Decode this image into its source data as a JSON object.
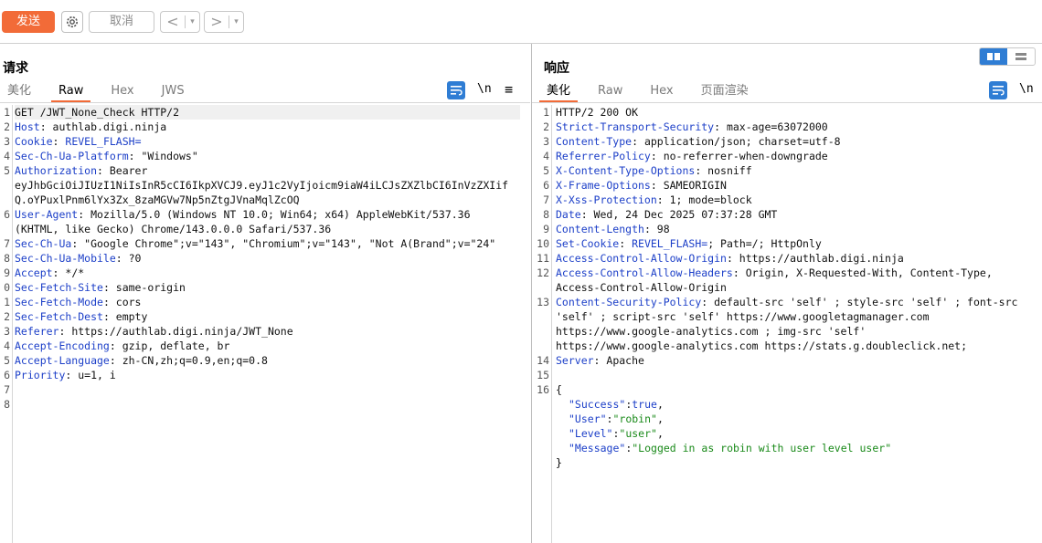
{
  "toolbar": {
    "send": "发送",
    "cancel": "取消",
    "back": "<",
    "forward": ">",
    "dropdown": "▾"
  },
  "request": {
    "title": "请求",
    "tabs": [
      "美化",
      "Raw",
      "Hex",
      "JWS"
    ],
    "active_tab": "Raw",
    "newline_label": "\\n",
    "menu_label": "≡",
    "lines": [
      {
        "num": "1",
        "k": "",
        "v": "GET /JWT_None_Check HTTP/2"
      },
      {
        "num": "2",
        "k": "Host",
        "v": ": authlab.digi.ninja"
      },
      {
        "num": "3",
        "k": "Cookie",
        "v": ": ",
        "k2": "REVEL_FLASH="
      },
      {
        "num": "4",
        "k": "Sec-Ch-Ua-Platform",
        "v": ": \"Windows\""
      },
      {
        "num": "5",
        "k": "Authorization",
        "v": ": Bearer"
      },
      {
        "num": "",
        "k": "",
        "v": "eyJhbGciOiJIUzI1NiIsInR5cCI6IkpXVCJ9.eyJ1c2VyIjoicm9iaW4iLCJsZXZlbCI6InVzZXIif"
      },
      {
        "num": "",
        "k": "",
        "v": "Q.oYPuxlPnm6lYx3Zx_8zaMGVw7Np5nZtgJVnaMqlZcOQ"
      },
      {
        "num": "6",
        "k": "User-Agent",
        "v": ": Mozilla/5.0 (Windows NT 10.0; Win64; x64) AppleWebKit/537.36"
      },
      {
        "num": "",
        "k": "",
        "v": "(KHTML, like Gecko) Chrome/143.0.0.0 Safari/537.36"
      },
      {
        "num": "7",
        "k": "Sec-Ch-Ua",
        "v": ": \"Google Chrome\";v=\"143\", \"Chromium\";v=\"143\", \"Not A(Brand\";v=\"24\""
      },
      {
        "num": "8",
        "k": "Sec-Ch-Ua-Mobile",
        "v": ": ?0"
      },
      {
        "num": "9",
        "k": "Accept",
        "v": ": */*"
      },
      {
        "num": "0",
        "k": "Sec-Fetch-Site",
        "v": ": same-origin"
      },
      {
        "num": "1",
        "k": "Sec-Fetch-Mode",
        "v": ": cors"
      },
      {
        "num": "2",
        "k": "Sec-Fetch-Dest",
        "v": ": empty"
      },
      {
        "num": "3",
        "k": "Referer",
        "v": ": https://authlab.digi.ninja/JWT_None"
      },
      {
        "num": "4",
        "k": "Accept-Encoding",
        "v": ": gzip, deflate, br"
      },
      {
        "num": "5",
        "k": "Accept-Language",
        "v": ": zh-CN,zh;q=0.9,en;q=0.8"
      },
      {
        "num": "6",
        "k": "Priority",
        "v": ": u=1, i"
      },
      {
        "num": "7",
        "k": "",
        "v": ""
      },
      {
        "num": "8",
        "k": "",
        "v": ""
      }
    ]
  },
  "response": {
    "title": "响应",
    "tabs": [
      "美化",
      "Raw",
      "Hex",
      "页面渲染"
    ],
    "active_tab": "美化",
    "newline_label": "\\n",
    "lines": [
      {
        "num": "1",
        "k": "",
        "v": "HTTP/2 200 OK"
      },
      {
        "num": "2",
        "k": "Strict-Transport-Security",
        "v": ": max-age=63072000"
      },
      {
        "num": "3",
        "k": "Content-Type",
        "v": ": application/json; charset=utf-8"
      },
      {
        "num": "4",
        "k": "Referrer-Policy",
        "v": ": no-referrer-when-downgrade"
      },
      {
        "num": "5",
        "k": "X-Content-Type-Options",
        "v": ": nosniff"
      },
      {
        "num": "6",
        "k": "X-Frame-Options",
        "v": ": SAMEORIGIN"
      },
      {
        "num": "7",
        "k": "X-Xss-Protection",
        "v": ": 1; mode=block"
      },
      {
        "num": "8",
        "k": "Date",
        "v": ": Wed, 24 Dec 2025 07:37:28 GMT"
      },
      {
        "num": "9",
        "k": "Content-Length",
        "v": ": 98"
      },
      {
        "num": "10",
        "k": "Set-Cookie",
        "v": ": ",
        "k2": "REVEL_FLASH=",
        "v2": "; Path=/; HttpOnly"
      },
      {
        "num": "11",
        "k": "Access-Control-Allow-Origin",
        "v": ": https://authlab.digi.ninja"
      },
      {
        "num": "12",
        "k": "Access-Control-Allow-Headers",
        "v": ": Origin, X-Requested-With, Content-Type,"
      },
      {
        "num": "",
        "k": "",
        "v": "Access-Control-Allow-Origin"
      },
      {
        "num": "13",
        "k": "Content-Security-Policy",
        "v": ": default-src 'self' ; style-src 'self' ; font-src"
      },
      {
        "num": "",
        "k": "",
        "v": "'self' ; script-src 'self' https://www.googletagmanager.com"
      },
      {
        "num": "",
        "k": "",
        "v": "https://www.google-analytics.com ; img-src 'self'"
      },
      {
        "num": "",
        "k": "",
        "v": "https://www.google-analytics.com https://stats.g.doubleclick.net;"
      },
      {
        "num": "14",
        "k": "Server",
        "v": ": Apache"
      },
      {
        "num": "15",
        "k": "",
        "v": ""
      },
      {
        "num": "16",
        "k": "",
        "v": "{"
      }
    ],
    "json_lines": [
      {
        "key": "\"Success\"",
        "val": "true",
        "val_is_string": false,
        "comma": ","
      },
      {
        "key": "\"User\"",
        "val": "\"robin\"",
        "val_is_string": true,
        "comma": ","
      },
      {
        "key": "\"Level\"",
        "val": "\"user\"",
        "val_is_string": true,
        "comma": ","
      },
      {
        "key": "\"Message\"",
        "val": "\"Logged in as robin with user level user\"",
        "val_is_string": true,
        "comma": ""
      }
    ],
    "json_close": "}"
  }
}
